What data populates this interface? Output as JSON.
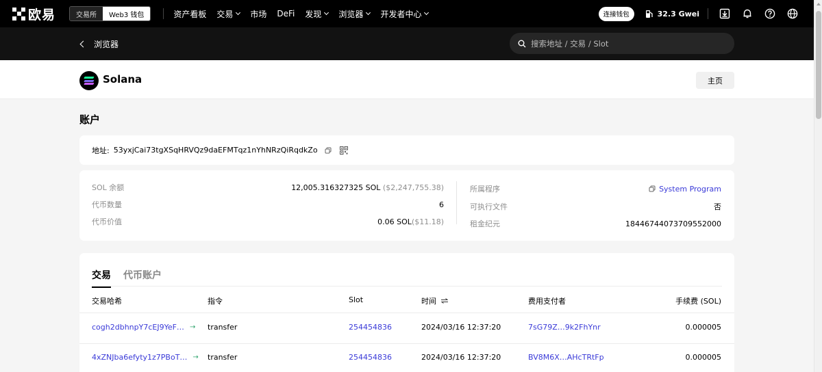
{
  "topbar": {
    "logo_text": "欧易",
    "switch": {
      "exchange": "交易所",
      "web3": "Web3 钱包"
    },
    "nav": [
      {
        "label": "资产看板",
        "dropdown": false
      },
      {
        "label": "交易",
        "dropdown": true
      },
      {
        "label": "市场",
        "dropdown": false
      },
      {
        "label": "DeFi",
        "dropdown": false
      },
      {
        "label": "发现",
        "dropdown": true
      },
      {
        "label": "浏览器",
        "dropdown": true
      },
      {
        "label": "开发者中心",
        "dropdown": true
      }
    ],
    "connect_wallet": "连接钱包",
    "gas": "32.3 Gwei"
  },
  "subbar": {
    "back_label": "浏览器",
    "search_placeholder": "搜索地址 / 交易 / Slot"
  },
  "chain": {
    "name": "Solana",
    "home_button": "主页"
  },
  "page_title": "账户",
  "address": {
    "label": "地址:",
    "value": "53yxjCai73tgXSqHRVQz9daEFMTqz1nYhNRzQiRqdkZo"
  },
  "info": {
    "left": [
      {
        "key": "SOL 余额",
        "value": "12,005.316327325 SOL",
        "sub": " ($2,247,755.38)"
      },
      {
        "key": "代币数量",
        "value": "6",
        "sub": ""
      },
      {
        "key": "代币价值",
        "value": "0.06 SOL",
        "sub": "($11.18)"
      }
    ],
    "right": [
      {
        "key": "所属程序",
        "value": "System Program"
      },
      {
        "key": "可执行文件",
        "value": "否"
      },
      {
        "key": "租金纪元",
        "value": "18446744073709552000"
      }
    ]
  },
  "transactions": {
    "tabs": [
      "交易",
      "代币账户"
    ],
    "columns": [
      "交易哈希",
      "指令",
      "Slot",
      "时间",
      "费用支付者",
      "手续费 (SOL)"
    ],
    "rows": [
      {
        "hash": "cogh2dbhnpY7cEJ9YeF…",
        "instruction": "transfer",
        "slot": "254454836",
        "time": "2024/03/16 12:37:20",
        "payer": "7sG79Z…9k2FhYnr",
        "fee": "0.000005"
      },
      {
        "hash": "4xZNJba6efyty1z7PBoT…",
        "instruction": "transfer",
        "slot": "254454836",
        "time": "2024/03/16 12:37:20",
        "payer": "BV8M6X…AHcTRtFp",
        "fee": "0.000005"
      }
    ]
  },
  "colors": {
    "accent_link": "#3a3ad8",
    "success_arrow": "#2ca36b",
    "topbar_bg": "#000000"
  }
}
